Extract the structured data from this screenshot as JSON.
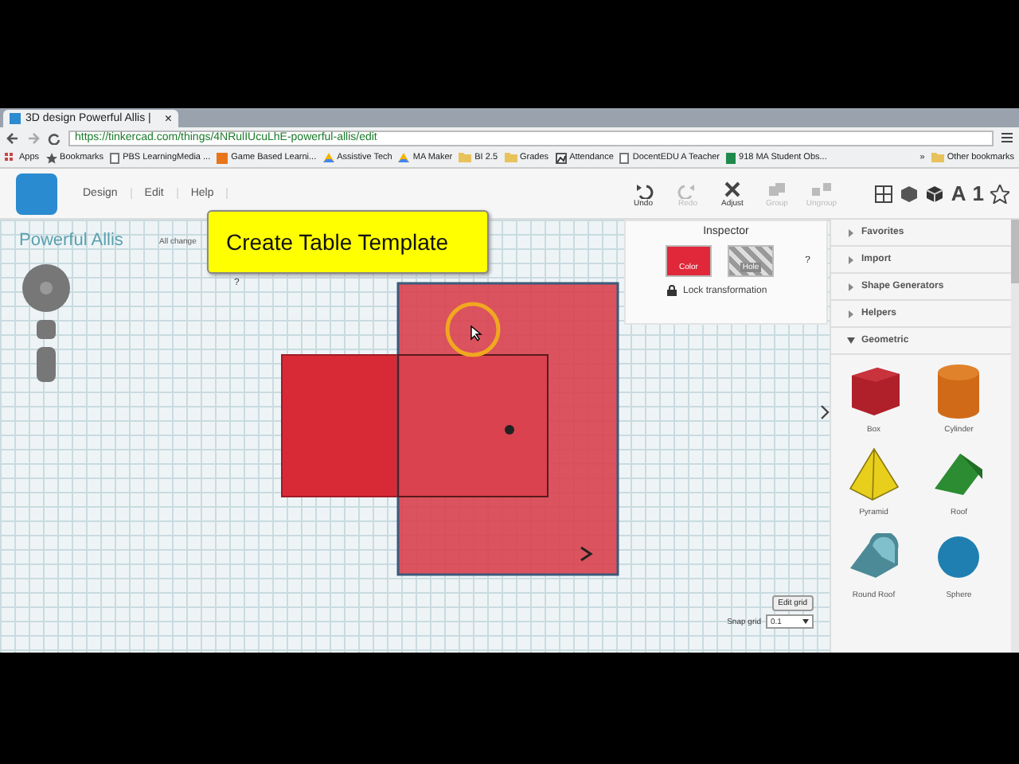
{
  "browser": {
    "tab_title": "3D design Powerful Allis |",
    "tab_close": "×",
    "url": "https://tinkercad.com/things/4NRulIUcuLhE-powerful-allis/edit",
    "bookmarks": [
      {
        "label": "Apps",
        "kind": "apps"
      },
      {
        "label": "Bookmarks",
        "kind": "star"
      },
      {
        "label": "PBS LearningMedia ...",
        "kind": "page"
      },
      {
        "label": "Game Based Learni...",
        "kind": "orange"
      },
      {
        "label": "Assistive Tech",
        "kind": "drive"
      },
      {
        "label": "MA Maker",
        "kind": "drive"
      },
      {
        "label": "BI 2.5",
        "kind": "folder"
      },
      {
        "label": "Grades",
        "kind": "folder"
      },
      {
        "label": "Attendance",
        "kind": "chart"
      },
      {
        "label": "DocentEDU A Teacher",
        "kind": "page"
      },
      {
        "label": "918 MA Student Obs...",
        "kind": "sheet"
      }
    ],
    "overflow": "»",
    "other_bookmarks": "Other bookmarks"
  },
  "app": {
    "menu": [
      "Design",
      "Edit",
      "Help"
    ],
    "tools": [
      {
        "label": "Undo",
        "kind": "undo",
        "disabled": false
      },
      {
        "label": "Redo",
        "kind": "redo",
        "disabled": true
      },
      {
        "label": "Adjust",
        "kind": "adjust",
        "disabled": false
      },
      {
        "label": "Group",
        "kind": "group",
        "disabled": true
      },
      {
        "label": "Ungroup",
        "kind": "ungroup",
        "disabled": true
      }
    ],
    "view_labels": [
      "A",
      "1"
    ],
    "project_title": "Powerful Allis",
    "save_status": "All change",
    "help_mark": "?",
    "callout": "Create Table Template",
    "inspector": {
      "title": "Inspector",
      "color_label": "Color",
      "hole_label": "Hole",
      "help": "?",
      "lock_label": "Lock transformation"
    },
    "sections": [
      {
        "label": "Favorites",
        "expanded": false
      },
      {
        "label": "Import",
        "expanded": false
      },
      {
        "label": "Shape Generators",
        "expanded": false
      },
      {
        "label": "Helpers",
        "expanded": false
      },
      {
        "label": "Geometric",
        "expanded": true
      }
    ],
    "shapes": [
      {
        "label": "Box",
        "kind": "box"
      },
      {
        "label": "Cylinder",
        "kind": "cylinder"
      },
      {
        "label": "Pyramid",
        "kind": "pyramid"
      },
      {
        "label": "Roof",
        "kind": "roof"
      },
      {
        "label": "Round Roof",
        "kind": "roundroof"
      },
      {
        "label": "Sphere",
        "kind": "sphere"
      }
    ],
    "edit_grid": "Edit grid",
    "snap_label": "Snap grid",
    "snap_value": "0.1"
  }
}
